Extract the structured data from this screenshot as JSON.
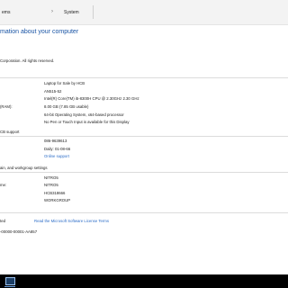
{
  "breadcrumb": {
    "parent": "ems",
    "separator": "›",
    "current": "System"
  },
  "heading": "mation about your computer",
  "windows_edition": {
    "copyright": "Corporation. All rights reserved."
  },
  "system": {
    "manufacturer": "Laptop for Sale by HCB",
    "model": "AN515-52",
    "processor": "Intel(R) Core(TM) i5-8300H CPU @ 2.30GHz   2.30 GHz",
    "ram_label": "(RAM):",
    "ram": "8.00 GB (7.85 GB usable)",
    "system_type": "64-bit Operating System, x64-based processor",
    "pen_touch": "No Pen or Touch Input is available for this Display"
  },
  "support": {
    "title": "CB support",
    "phone": "086-9639613",
    "hours": "Daily: 01-08-66",
    "website": "Online support"
  },
  "computer_name": {
    "title": "ain, and workgroup settings",
    "computer_name": "NITRO5",
    "full_name_label": "me:",
    "full_name": "NITRO5",
    "description": "HCB318666",
    "workgroup": "WORKGROUP"
  },
  "activation": {
    "status_label": "ted",
    "license_link": "Read the Microsoft Software License Terms",
    "product_id": "-00000-00001-AA857"
  },
  "taskbar": {
    "app_icon": "explorer-window-icon"
  },
  "colors": {
    "heading": "#1a55a5",
    "link": "#2b6cc7",
    "background": "#ffffff",
    "taskbar": "#000000"
  }
}
